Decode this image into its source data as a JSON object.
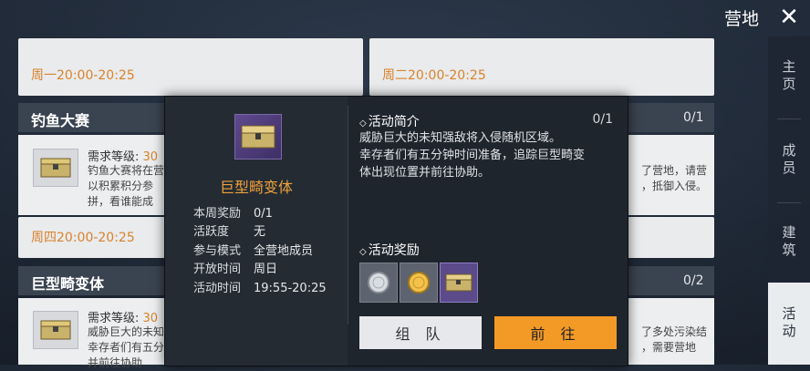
{
  "header": {
    "title": "营地",
    "close_icon": "close-icon"
  },
  "side_tabs": [
    "主页",
    "成员",
    "建筑",
    "活动"
  ],
  "cards": {
    "top_left_time": "周一20:00-20:25",
    "top_right_time": "周二20:00-20:25",
    "fishing": {
      "title": "钓鱼大赛",
      "count": "0/1",
      "req_label": "需求等级: 30",
      "desc": [
        "钓鱼大赛将在营",
        "以积累积分参",
        "拼，看谁能成"
      ],
      "right_desc": [
        "了营地，请营",
        "，抵御入侵。"
      ],
      "time": "周四20:00-20:25"
    },
    "giant": {
      "title": "巨型畸变体",
      "count": "0/2",
      "req_label": "需求等级: 30",
      "desc": [
        "威胁巨大的未知",
        "幸存者们有五分",
        "并前往协助"
      ],
      "right_desc": [
        "了多处污染结",
        "，需要营地"
      ]
    }
  },
  "modal": {
    "item_name": "巨型畸变体",
    "info": [
      {
        "label": "本周奖励",
        "value": "0/1"
      },
      {
        "label": "活跃度",
        "value": "无"
      },
      {
        "label": "参与模式",
        "value": "全营地成员"
      },
      {
        "label": "开放时间",
        "value": "周日"
      },
      {
        "label": "活动时间",
        "value": "19:55-20:25"
      }
    ],
    "intro_title": "活动简介",
    "intro_count": "0/1",
    "intro_text": [
      "威胁巨大的未知强敌将入侵随机区域。",
      "幸存者们有五分钟时间准备，追踪巨型畸变",
      "体出现位置并前往协助。"
    ],
    "reward_title": "活动奖励",
    "rewards": [
      "silver-coin-icon",
      "gold-coin-icon",
      "chest-icon"
    ],
    "team_button": "组 队",
    "go_button": "前 往"
  }
}
